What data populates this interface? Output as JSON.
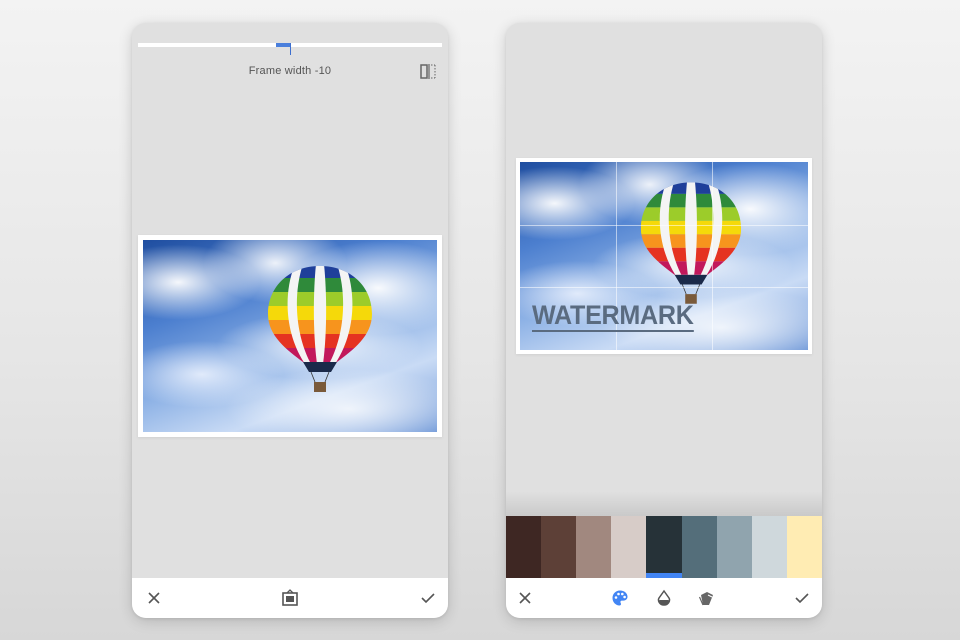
{
  "left_screen": {
    "slider": {
      "label": "Frame width -10",
      "value_fraction": 0.5
    },
    "icons": {
      "compare": "compare-split-icon",
      "cancel": "close-icon",
      "style": "frame-style-icon",
      "apply": "check-icon"
    }
  },
  "right_screen": {
    "watermark_text": "WATERMARK",
    "palette": [
      {
        "color": "#3e2723",
        "selected": false
      },
      {
        "color": "#5d4037",
        "selected": false
      },
      {
        "color": "#a1887f",
        "selected": false
      },
      {
        "color": "#d7ccc8",
        "selected": false
      },
      {
        "color": "#263238",
        "selected": true
      },
      {
        "color": "#546e7a",
        "selected": false
      },
      {
        "color": "#90a4ae",
        "selected": false
      },
      {
        "color": "#cfd8dc",
        "selected": false
      },
      {
        "color": "#ffecb3",
        "selected": false
      }
    ],
    "icons": {
      "cancel": "close-icon",
      "color": "palette-icon",
      "opacity": "opacity-drop-icon",
      "style": "layers-style-icon",
      "apply": "check-icon"
    }
  },
  "colors": {
    "accent": "#4285f4",
    "screen_bg": "#e0e0e0",
    "bar_bg": "#ffffff"
  }
}
